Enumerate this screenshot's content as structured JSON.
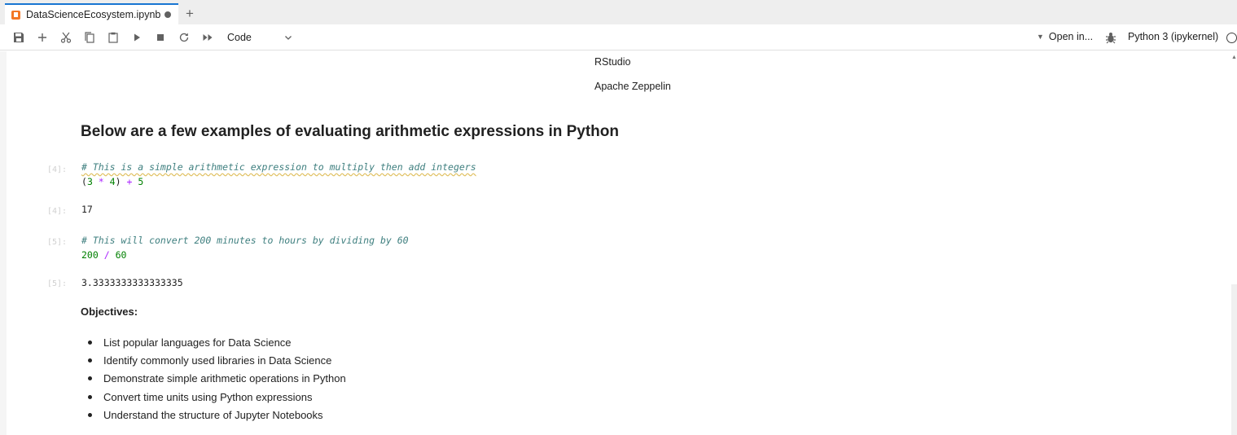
{
  "tab": {
    "title": "DataScienceEcosystem.ipynb",
    "new_tab_label": "+"
  },
  "toolbar": {
    "buttons": [
      "save-icon",
      "add-cell-icon",
      "cut-icon",
      "copy-icon",
      "paste-icon",
      "run-icon",
      "stop-icon",
      "restart-icon",
      "run-all-icon"
    ],
    "cell_type": "Code",
    "open_in": "Open in...",
    "kernel": "Python 3 (ipykernel)"
  },
  "markdown_top": {
    "line1": "RStudio",
    "line2": "Apache Zeppelin"
  },
  "heading": "Below are a few examples of evaluating arithmetic expressions in Python",
  "cells": [
    {
      "prompt": "[4]:",
      "comment": "# This is a simple arithmetic expression to multiply then add integers",
      "code_tokens": [
        "(",
        "3",
        " * ",
        "4",
        ") ",
        "+",
        " 5"
      ],
      "out_prompt": "[4]:",
      "output": "17"
    },
    {
      "prompt": "[5]:",
      "comment": "# This will convert 200 minutes to hours by dividing by 60",
      "code_tokens": [
        "200",
        " / ",
        "60"
      ],
      "out_prompt": "[5]:",
      "output": "3.3333333333333335"
    }
  ],
  "objectives": {
    "title": "Objectives:",
    "items": [
      "List popular languages for Data Science",
      "Identify commonly used libraries in Data Science",
      "Demonstrate simple arithmetic operations in Python",
      "Convert time units using Python expressions",
      "Understand the structure of Jupyter Notebooks"
    ]
  }
}
